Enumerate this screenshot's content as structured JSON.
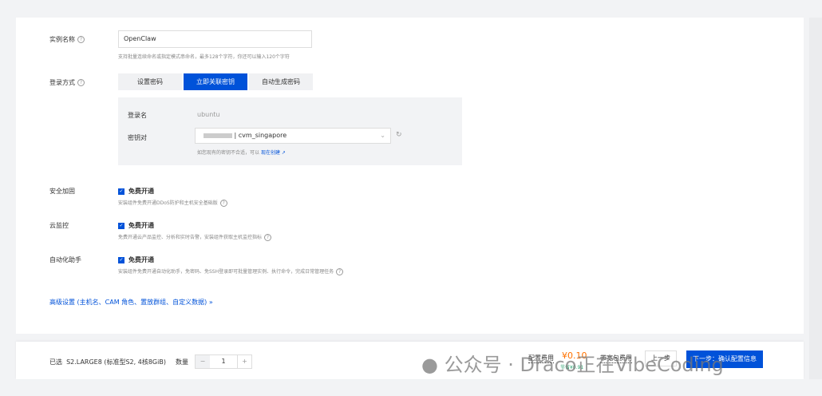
{
  "instance_name": {
    "label": "实例名称",
    "value": "OpenClaw",
    "hint": "支持批量连续命名或指定模式串命名，最多128个字符，你还可以输入120个字符"
  },
  "login": {
    "label": "登录方式",
    "tabs": [
      "设置密码",
      "立即关联密钥",
      "自动生成密码"
    ],
    "active_tab": 1,
    "username_label": "登录名",
    "username": "ubuntu",
    "keypair_label": "密钥对",
    "keypair_value": "| cvm_singapore",
    "keypair_hint": "如您现有的密钥不合适，可以",
    "create_link": "现在创建"
  },
  "options": [
    {
      "label": "安全加固",
      "check": "免费开通",
      "hint": "安装组件免费开通DDoS防护和主机安全基础版"
    },
    {
      "label": "云监控",
      "check": "免费开通",
      "hint": "免费开通云产品监控、分析和实时告警，安装组件获取主机监控指标"
    },
    {
      "label": "自动化助手",
      "check": "免费开通",
      "hint": "安装组件免费开通自动化助手，免密码、免SSH登录即可批量管理实例、执行命令，完成日常管理任务"
    }
  ],
  "advanced": "高级设置 (主机名、CAM 角色、置放群组、自定义数据)",
  "footer": {
    "selected_label": "已选",
    "selected_value": "S2.LARGE8 (标准型S2, 4核8GiB)",
    "qty_label": "数量",
    "qty": "1",
    "minus": "−",
    "plus": "+",
    "fee_label": "配置费用",
    "fee": "¥0.10",
    "saving": "节省¥0.91",
    "bandwidth_label": "带宽包费用",
    "prev": "上一步",
    "next": "下一步：确认配置信息"
  },
  "watermark": "公众号 · Draco正在VibeCoding"
}
